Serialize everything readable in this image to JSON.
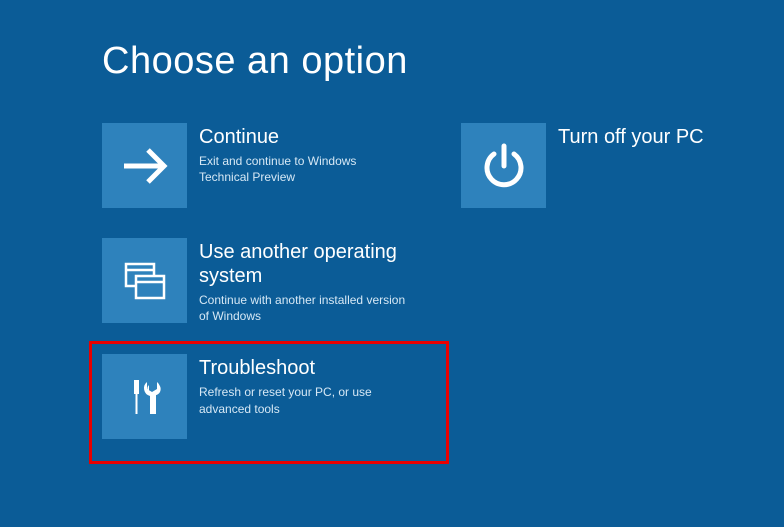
{
  "page_title": "Choose an option",
  "colors": {
    "background": "#0b5c97",
    "tile": "#2e82bc",
    "highlight_border": "#e80000"
  },
  "options": {
    "continue": {
      "title": "Continue",
      "desc": "Exit and continue to Windows Technical Preview",
      "icon": "arrow-right-icon"
    },
    "use_another_os": {
      "title": "Use another operating system",
      "desc": "Continue with another installed version of Windows",
      "icon": "windows-stack-icon"
    },
    "troubleshoot": {
      "title": "Troubleshoot",
      "desc": "Refresh or reset your PC, or use advanced tools",
      "icon": "tools-icon",
      "highlighted": true
    },
    "turn_off": {
      "title": "Turn off your PC",
      "desc": "",
      "icon": "power-icon"
    }
  }
}
